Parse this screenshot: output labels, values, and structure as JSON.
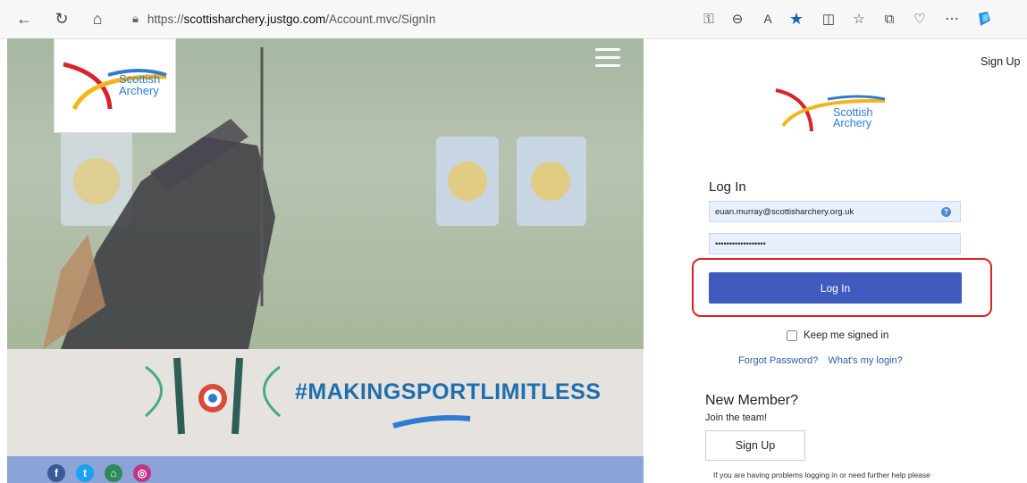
{
  "browser": {
    "url_prefix": "https://",
    "url_host": "scottisharchery.justgo.com",
    "url_path": "/Account.mvc/SignIn"
  },
  "hero": {
    "brand_line1": "Scottish",
    "brand_line2": "Archery",
    "hashtag": "#MAKINGSPORTLIMITLESS"
  },
  "header": {
    "signup_link": "Sign Up"
  },
  "logo": {
    "line1": "Scottish",
    "line2": "Archery"
  },
  "login": {
    "title": "Log In",
    "email_value": "euan.murray@scottisharchery.org.uk",
    "password_value": "••••••••••••••••••",
    "button_label": "Log In",
    "keep_signed_in": "Keep me signed in",
    "forgot_password": "Forgot Password?",
    "whats_my_login": "What's my login?"
  },
  "new_member": {
    "title": "New Member?",
    "subtitle": "Join the team!",
    "signup_button": "Sign Up",
    "help_text": "If you are having problems logging in or need further help please"
  },
  "colors": {
    "primary_button": "#3f5bbd",
    "highlight": "#e02020",
    "link": "#2a5db0",
    "hashtag": "#1e6fae"
  }
}
